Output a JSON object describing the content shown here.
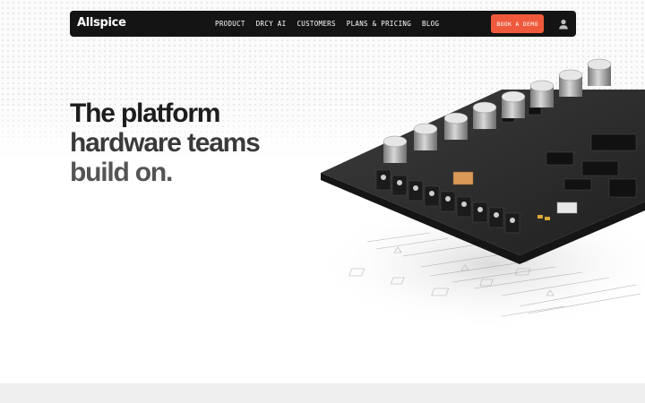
{
  "brand": {
    "logo_text": "Allspice"
  },
  "nav": {
    "links": [
      {
        "label": "PRODUCT"
      },
      {
        "label": "DRCY AI"
      },
      {
        "label": "CUSTOMERS"
      },
      {
        "label": "PLANS & PRICING"
      },
      {
        "label": "BLOG"
      }
    ],
    "cta_label": "BOOK A DEMO",
    "user_icon": "user-icon"
  },
  "hero": {
    "headline_lines": [
      "The platform",
      "hardware teams",
      "build on."
    ],
    "image": "circuit-board-illustration"
  },
  "colors": {
    "navbar_bg": "#141414",
    "cta_bg": "#ef5a3c",
    "headline": "#1d1d1d",
    "footer_band": "#efefef"
  }
}
